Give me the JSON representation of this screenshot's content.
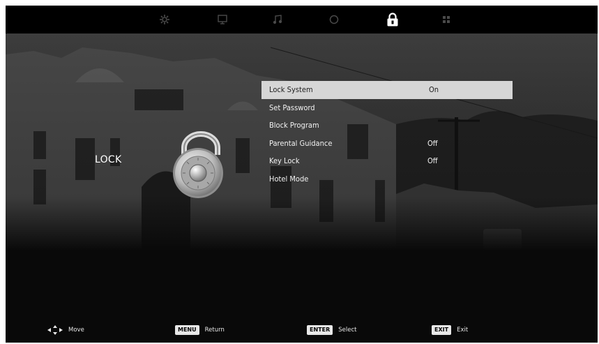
{
  "tabs": [
    {
      "icon": "gear-icon",
      "active": false
    },
    {
      "icon": "monitor-icon",
      "active": false
    },
    {
      "icon": "music-note-icon",
      "active": false
    },
    {
      "icon": "circle-icon",
      "active": false
    },
    {
      "icon": "lock-icon",
      "active": true
    },
    {
      "icon": "grid-icon",
      "active": false
    }
  ],
  "page": {
    "title": "LOCK"
  },
  "menu": {
    "items": [
      {
        "label": "Lock System",
        "value": "On",
        "selected": true
      },
      {
        "label": "Set Password",
        "value": ""
      },
      {
        "label": "Block Program",
        "value": ""
      },
      {
        "label": "Parental Guidance",
        "value": "Off"
      },
      {
        "label": "Key Lock",
        "value": "Off"
      },
      {
        "label": "Hotel Mode",
        "value": ""
      }
    ]
  },
  "footer": {
    "move": {
      "label": "Move",
      "icon": "dpad-icon"
    },
    "menu": {
      "key": "MENU",
      "label": "Return"
    },
    "enter": {
      "key": "ENTER",
      "label": "Select"
    },
    "exit": {
      "key": "EXIT",
      "label": "Exit"
    }
  }
}
